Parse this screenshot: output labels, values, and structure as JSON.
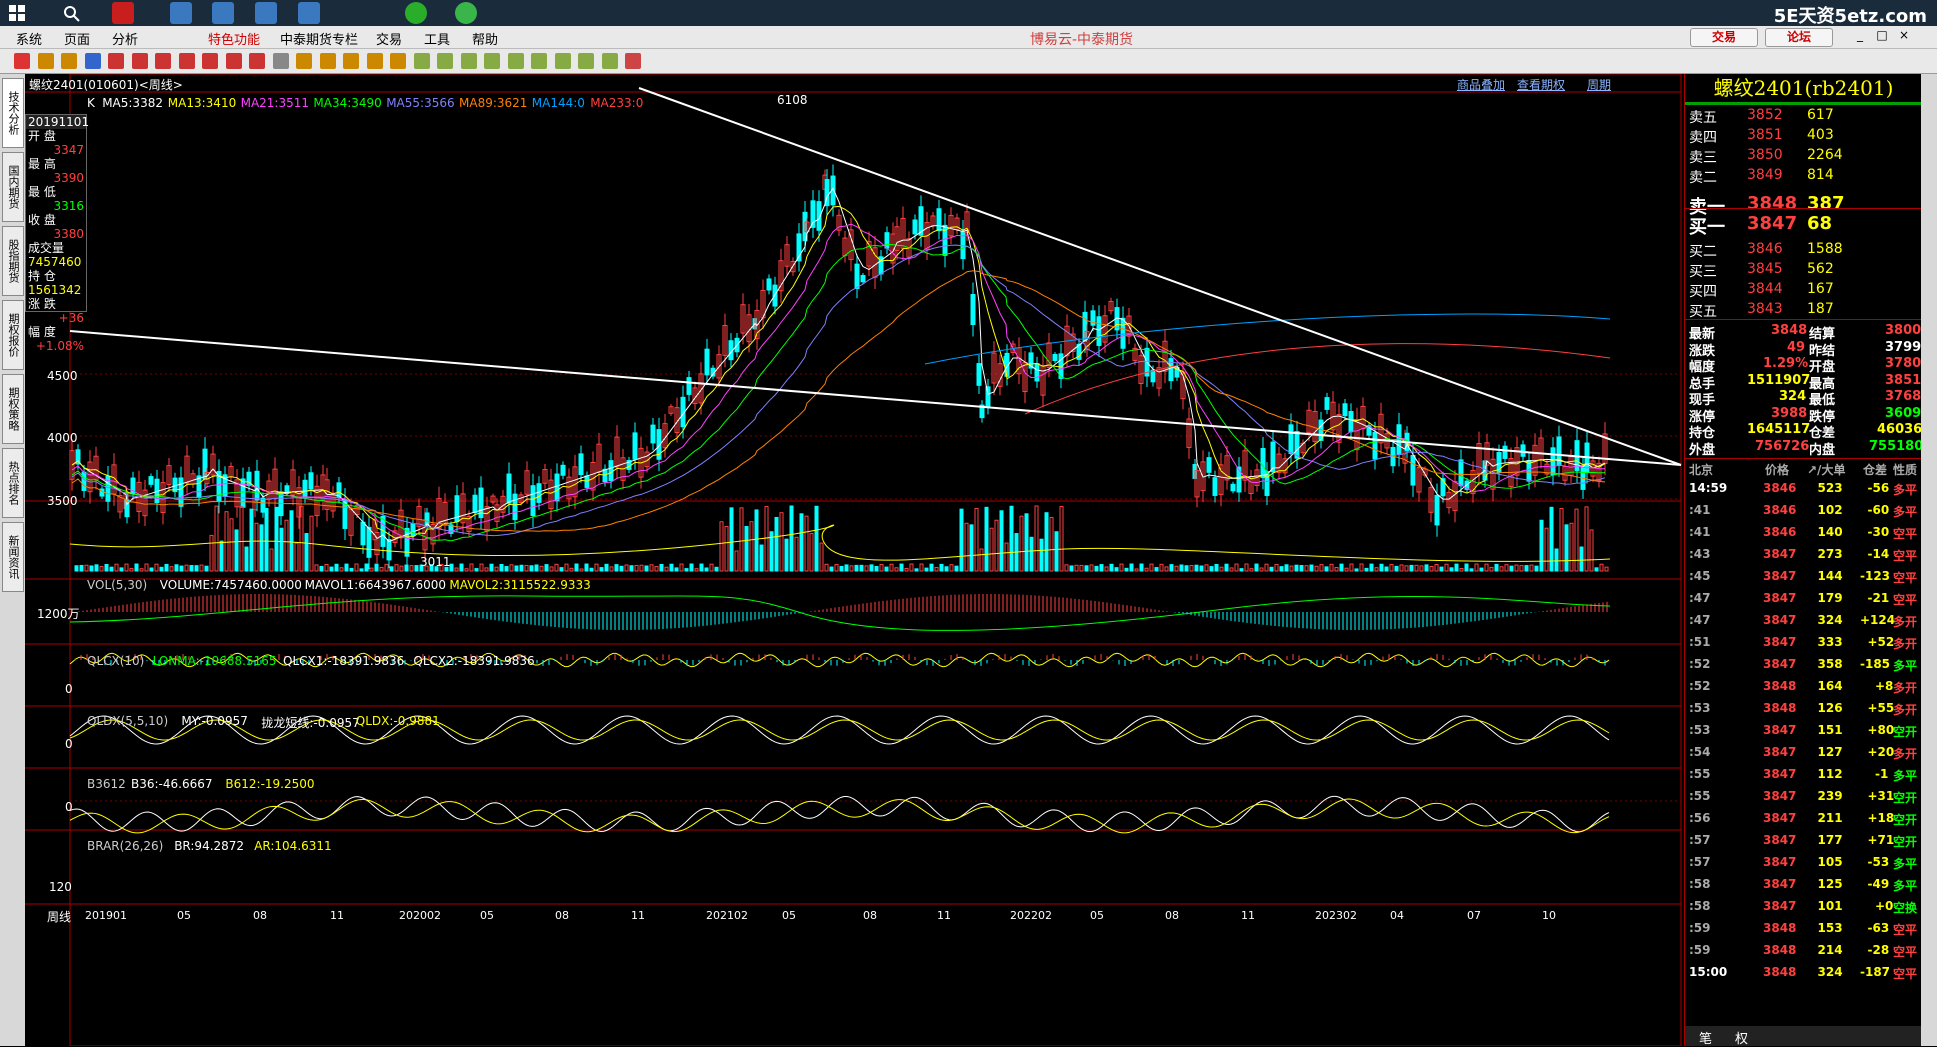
{
  "watermark": "5E天资5etz.com",
  "menu": [
    "系统",
    "页面",
    "分析",
    "特色功能",
    "中泰期货专栏",
    "交易",
    "工具",
    "帮助"
  ],
  "app_title": "博易云-中泰期货",
  "trade_button": "交易",
  "forum_button": "论坛",
  "left_tabs": [
    "技术分析",
    "国内期货",
    "股指期货",
    "期权报价",
    "期权策略",
    "热点排名",
    "新闻资讯"
  ],
  "chart": {
    "title": "螺纹2401(010601)<周线>",
    "ma_line": [
      {
        "t": "K",
        "c": "#ffffff"
      },
      {
        "t": "MA5:3382",
        "c": "#ffffff"
      },
      {
        "t": "MA13:3410",
        "c": "#ffff00"
      },
      {
        "t": "MA21:3511",
        "c": "#ff40ff"
      },
      {
        "t": "MA34:3490",
        "c": "#00ff00"
      },
      {
        "t": "MA55:3566",
        "c": "#8080ff"
      },
      {
        "t": "MA89:3621",
        "c": "#ff8000"
      },
      {
        "t": "MA144:0",
        "c": "#00a0ff"
      },
      {
        "t": "MA233:0",
        "c": "#ff4040"
      }
    ],
    "links": [
      "商品叠加",
      "查看期权",
      "周期"
    ],
    "info_box": {
      "date": "20191101",
      "open_label": "开  盘",
      "open": "3347",
      "high_label": "最  高",
      "high": "3390",
      "low_label": "最  低",
      "low": "3316",
      "close_label": "收  盘",
      "close": "3380",
      "vol_label": "成交量",
      "vol": "7457460",
      "oi_label": "持  仓",
      "oi": "1561342",
      "chg_label": "涨  跌",
      "chg": "+36",
      "pct_label": "幅  度",
      "pct": "+1.08%"
    },
    "y_labels": [
      "4500",
      "4000",
      "3500"
    ],
    "high_mark": "6108",
    "low_mark": "3011",
    "vol_header": [
      {
        "t": "VOL(5,30)",
        "c": "#cccccc"
      },
      {
        "t": "VOLUME:7457460.0000",
        "c": "#ffffff"
      },
      {
        "t": "MAVOL1:6643967.6000",
        "c": "#ffffff"
      },
      {
        "t": "MAVOL2:3115522.9333",
        "c": "#ffff00"
      }
    ],
    "vol_y": "1200万",
    "qlcx_header": [
      {
        "t": "QLCX(10)",
        "c": "#cccccc"
      },
      {
        "t": "LONMA:-19688.5165",
        "c": "#00ff00"
      },
      {
        "t": "QLCX1:-18391.9836",
        "c": "#ffffff"
      },
      {
        "t": "QLCX2:-18391.9836",
        "c": "#ffffff"
      }
    ],
    "qldx_header": [
      {
        "t": "QLDX(5,5,10)",
        "c": "#cccccc"
      },
      {
        "t": "MY:-0.0957",
        "c": "#ffffff"
      },
      {
        "t": "拢龙短线:-0.0957",
        "c": "#ffffff"
      },
      {
        "t": "QLDX:-0.9881",
        "c": "#ffff00"
      }
    ],
    "b3612_header": [
      {
        "t": "B3612",
        "c": "#cccccc"
      },
      {
        "t": "B36:-46.6667",
        "c": "#ffffff"
      },
      {
        "t": "B612:-19.2500",
        "c": "#ffff00"
      }
    ],
    "brar_header": [
      {
        "t": "BRAR(26,26)",
        "c": "#cccccc"
      },
      {
        "t": "BR:94.2872",
        "c": "#ffffff"
      },
      {
        "t": "AR:104.6311",
        "c": "#ffff00"
      }
    ],
    "zero": "0",
    "brar_y": "120",
    "period_label": "周线",
    "x_labels": [
      "201901",
      "05",
      "08",
      "11",
      "202002",
      "05",
      "08",
      "11",
      "202102",
      "05",
      "08",
      "11",
      "202202",
      "05",
      "08",
      "11",
      "202302",
      "04",
      "07",
      "10"
    ]
  },
  "panel": {
    "title": "螺纹2401(rb2401)",
    "asks": [
      {
        "label": "卖五",
        "price": "3852",
        "vol": "617"
      },
      {
        "label": "卖四",
        "price": "3851",
        "vol": "403"
      },
      {
        "label": "卖三",
        "price": "3850",
        "vol": "2264"
      },
      {
        "label": "卖二",
        "price": "3849",
        "vol": "814"
      },
      {
        "label": "卖一",
        "price": "3848",
        "vol": "387"
      }
    ],
    "bids": [
      {
        "label": "买一",
        "price": "3847",
        "vol": "68"
      },
      {
        "label": "买二",
        "price": "3846",
        "vol": "1588"
      },
      {
        "label": "买三",
        "price": "3845",
        "vol": "562"
      },
      {
        "label": "买四",
        "price": "3844",
        "vol": "167"
      },
      {
        "label": "买五",
        "price": "3843",
        "vol": "187"
      }
    ],
    "stats": [
      {
        "l1": "最新",
        "v1": "3848",
        "c1": "#ff4040",
        "l2": "结算",
        "v2": "3800",
        "c2": "#ff4040"
      },
      {
        "l1": "涨跌",
        "v1": "49",
        "c1": "#ff4040",
        "l2": "昨结",
        "v2": "3799",
        "c2": "#ffffff"
      },
      {
        "l1": "幅度",
        "v1": "1.29%",
        "c1": "#ff4040",
        "l2": "开盘",
        "v2": "3780",
        "c2": "#ff4040"
      },
      {
        "l1": "总手",
        "v1": "1511907",
        "c1": "#ffff00",
        "l2": "最高",
        "v2": "3851",
        "c2": "#ff4040"
      },
      {
        "l1": "现手",
        "v1": "324",
        "c1": "#ffff00",
        "l2": "最低",
        "v2": "3768",
        "c2": "#ff4040"
      },
      {
        "l1": "涨停",
        "v1": "3988",
        "c1": "#ff4040",
        "l2": "跌停",
        "v2": "3609",
        "c2": "#00ff00"
      },
      {
        "l1": "持仓",
        "v1": "1645117",
        "c1": "#ffff00",
        "l2": "仓差",
        "v2": "46036",
        "c2": "#ffff00"
      },
      {
        "l1": "外盘",
        "v1": "756726",
        "c1": "#ff4040",
        "l2": "内盘",
        "v2": "755180",
        "c2": "#00ff00"
      }
    ],
    "tick_header": {
      "loc": "北京",
      "price": "价格",
      "big": "↗/大单",
      "oi": "仓差",
      "nature": "性质"
    },
    "ticks": [
      {
        "t": "14:59",
        "p": "3846",
        "v": "523",
        "d": "-56",
        "n": "多平",
        "nc": "#ff4040"
      },
      {
        "t": ":41",
        "p": "3846",
        "v": "102",
        "d": "-60",
        "n": "多平",
        "nc": "#ff4040"
      },
      {
        "t": ":41",
        "p": "3846",
        "v": "140",
        "d": "-30",
        "n": "空平",
        "nc": "#ff4040"
      },
      {
        "t": ":43",
        "p": "3847",
        "v": "273",
        "d": "-14",
        "n": "空平",
        "nc": "#ff4040"
      },
      {
        "t": ":45",
        "p": "3847",
        "v": "144",
        "d": "-123",
        "n": "空平",
        "nc": "#ff4040"
      },
      {
        "t": ":47",
        "p": "3847",
        "v": "179",
        "d": "-21",
        "n": "空平",
        "nc": "#ff4040"
      },
      {
        "t": ":47",
        "p": "3847",
        "v": "324",
        "d": "+124",
        "n": "多开",
        "nc": "#ff4040"
      },
      {
        "t": ":51",
        "p": "3847",
        "v": "333",
        "d": "+52",
        "n": "多开",
        "nc": "#ff4040"
      },
      {
        "t": ":52",
        "p": "3847",
        "v": "358",
        "d": "-185",
        "n": "多平",
        "nc": "#00ff00"
      },
      {
        "t": ":52",
        "p": "3848",
        "v": "164",
        "d": "+8",
        "n": "多开",
        "nc": "#ff4040"
      },
      {
        "t": ":53",
        "p": "3848",
        "v": "126",
        "d": "+55",
        "n": "多开",
        "nc": "#ff4040"
      },
      {
        "t": ":53",
        "p": "3847",
        "v": "151",
        "d": "+80",
        "n": "空开",
        "nc": "#00ff00"
      },
      {
        "t": ":54",
        "p": "3847",
        "v": "127",
        "d": "+20",
        "n": "多开",
        "nc": "#ff4040"
      },
      {
        "t": ":55",
        "p": "3847",
        "v": "112",
        "d": "-1",
        "n": "多平",
        "nc": "#00ff00"
      },
      {
        "t": ":55",
        "p": "3847",
        "v": "239",
        "d": "+31",
        "n": "空开",
        "nc": "#00ff00"
      },
      {
        "t": ":56",
        "p": "3847",
        "v": "211",
        "d": "+18",
        "n": "空开",
        "nc": "#00ff00"
      },
      {
        "t": ":57",
        "p": "3847",
        "v": "177",
        "d": "+71",
        "n": "空开",
        "nc": "#00ff00"
      },
      {
        "t": ":57",
        "p": "3847",
        "v": "105",
        "d": "-53",
        "n": "多平",
        "nc": "#00ff00"
      },
      {
        "t": ":58",
        "p": "3847",
        "v": "125",
        "d": "-49",
        "n": "多平",
        "nc": "#00ff00"
      },
      {
        "t": ":58",
        "p": "3847",
        "v": "101",
        "d": "+0",
        "n": "空换",
        "nc": "#00ff00"
      },
      {
        "t": ":59",
        "p": "3848",
        "v": "153",
        "d": "-63",
        "n": "空平",
        "nc": "#ff4040"
      },
      {
        "t": ":59",
        "p": "3848",
        "v": "214",
        "d": "-28",
        "n": "空平",
        "nc": "#ff4040"
      },
      {
        "t": "15:00",
        "p": "3848",
        "v": "324",
        "d": "-187",
        "n": "空平",
        "nc": "#ff4040"
      }
    ],
    "bottom_tabs": [
      "笔",
      "权"
    ]
  }
}
